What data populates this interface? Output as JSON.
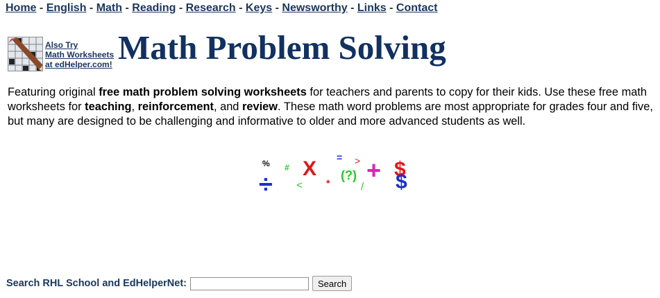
{
  "nav": {
    "items": [
      {
        "label": "Home"
      },
      {
        "label": "English"
      },
      {
        "label": "Math"
      },
      {
        "label": "Reading"
      },
      {
        "label": "Research"
      },
      {
        "label": "Keys"
      },
      {
        "label": "Newsworthy"
      },
      {
        "label": "Links"
      },
      {
        "label": "Contact"
      }
    ],
    "separator": "-"
  },
  "promo": {
    "line1": "Also Try",
    "line2": "Math Worksheets",
    "line3": "at edHelper.com!"
  },
  "header": {
    "title": "Math Problem Solving"
  },
  "intro": {
    "t1": "Featuring original ",
    "b1": "free math problem solving worksheets",
    "t2": " for teachers and parents to copy for their kids. Use these free math worksheets for ",
    "b2": "teaching",
    "t3": ", ",
    "b3": "reinforcement",
    "t4": ", and ",
    "b4": "review",
    "t5": ". These math word problems are most appropriate for grades four and five, but many are designed to be challenging and informative to older and more advanced students as well."
  },
  "math_graphic": {
    "symbols": [
      "%",
      "#",
      "X",
      "=",
      ">",
      "(?)",
      "+",
      "$",
      "÷",
      "<",
      "*",
      "/",
      "$"
    ],
    "colors": {
      "black": "#111111",
      "green": "#22cc22",
      "red": "#e01818",
      "blue": "#1a2fd0",
      "magenta": "#e020c0",
      "teal": "#118866"
    }
  },
  "search": {
    "label": "Search RHL School and EdHelperNet:",
    "value": "",
    "placeholder": "",
    "button_label": "Search"
  },
  "colors": {
    "nav_link": "#1c3760",
    "title": "#123160"
  }
}
